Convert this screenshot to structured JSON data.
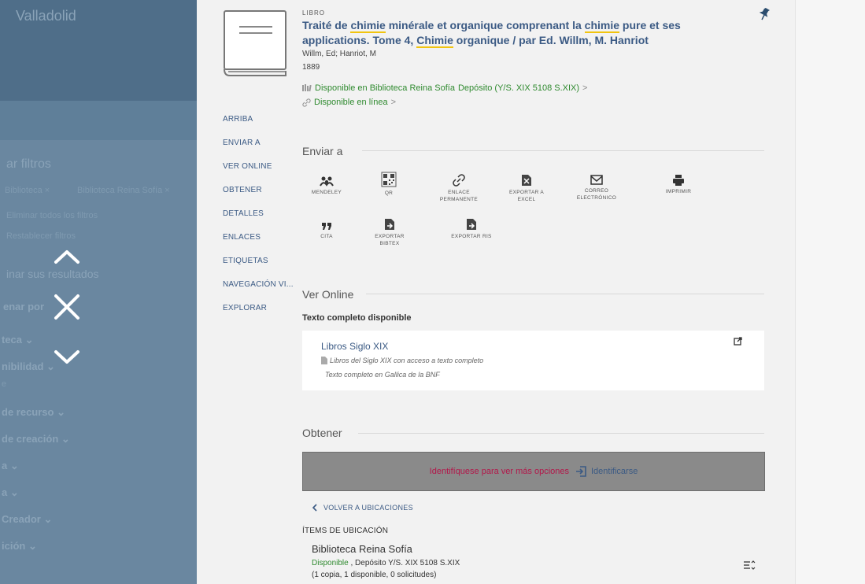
{
  "background": {
    "brand": "Valladolid",
    "filter_title": "ar filtros",
    "chips": [
      "Biblioteca ×",
      "Biblioteca Reina Sofía ×"
    ],
    "remove_filters": "Eliminar todos los filtros",
    "restore_filters": "Restablecer filtros",
    "refine_title": "inar sus resultados",
    "sort_label": "enar por",
    "facets": [
      "teca ⌄",
      "nibilidad ⌄",
      "e",
      "de recurso ⌄",
      "de creación ⌄",
      "a ⌄",
      "a ⌄",
      "Creador ⌄",
      "ición ⌄"
    ]
  },
  "overlay_nav": {
    "up": "previous-record",
    "close": "close-record",
    "down": "next-record"
  },
  "record": {
    "type": "LIBRO",
    "title_parts": [
      "Traité de ",
      "chimie",
      " minérale et organique comprenant la ",
      "chimie",
      " pure et ses applications. Tome 4, ",
      "Chimie",
      " organique / par Ed. Willm, M. Hanriot"
    ],
    "authors": "Willm, Ed; Hanriot, M",
    "year": "1889",
    "avail_physical_text": "Disponible en Biblioteca Reina Sofía",
    "avail_physical_location": "Depósito (Y/S. XIX 5108 S.XIX)",
    "avail_online_text": "Disponible en línea",
    "chevron": ">"
  },
  "side_nav": [
    "ARRIBA",
    "ENVIAR A",
    "VER ONLINE",
    "OBTENER",
    "DETALLES",
    "ENLACES",
    "ETIQUETAS",
    "NAVEGACIÓN VI...",
    "EXPLORAR"
  ],
  "send_to": {
    "title": "Enviar a",
    "items": [
      {
        "label1": "MENDELEY",
        "label2": ""
      },
      {
        "label1": "QR",
        "label2": ""
      },
      {
        "label1": "ENLACE",
        "label2": "PERMANENTE"
      },
      {
        "label1": "EXPORTAR A",
        "label2": "EXCEL"
      },
      {
        "label1": "CORREO",
        "label2": "ELECTRÓNICO"
      },
      {
        "label1": "IMPRIMIR",
        "label2": ""
      },
      {
        "label1": "CITA",
        "label2": ""
      },
      {
        "label1": "EXPORTAR",
        "label2": "BIBTEX"
      },
      {
        "label1": "EXPORTAR RIS",
        "label2": ""
      }
    ]
  },
  "view_online": {
    "title": "Ver Online",
    "heading": "Texto completo disponible",
    "link": "Libros Siglo XIX",
    "desc1": "Libros del Siglo XIX con acceso a texto completo",
    "desc2": "Texto completo en Gallica de la BNF"
  },
  "get_it": {
    "title": "Obtener",
    "login_message": "Identifíquese para ver más opciones",
    "login_button": "Identificarse",
    "back_link": "VOLVER A UBICACIONES",
    "items_heading": "ÍTEMS DE UBICACIÓN",
    "library": "Biblioteca Reina Sofía",
    "status": "Disponible",
    "status_rest": " , Depósito Y/S. XIX 5108 S.XIX",
    "copies": "(1 copia, 1 disponible, 0 solicitudes)"
  },
  "colors": {
    "link": "#3b5a84",
    "available": "#2f8a2f",
    "login_message": "#b3174a",
    "highlight": "#f1c40f"
  }
}
